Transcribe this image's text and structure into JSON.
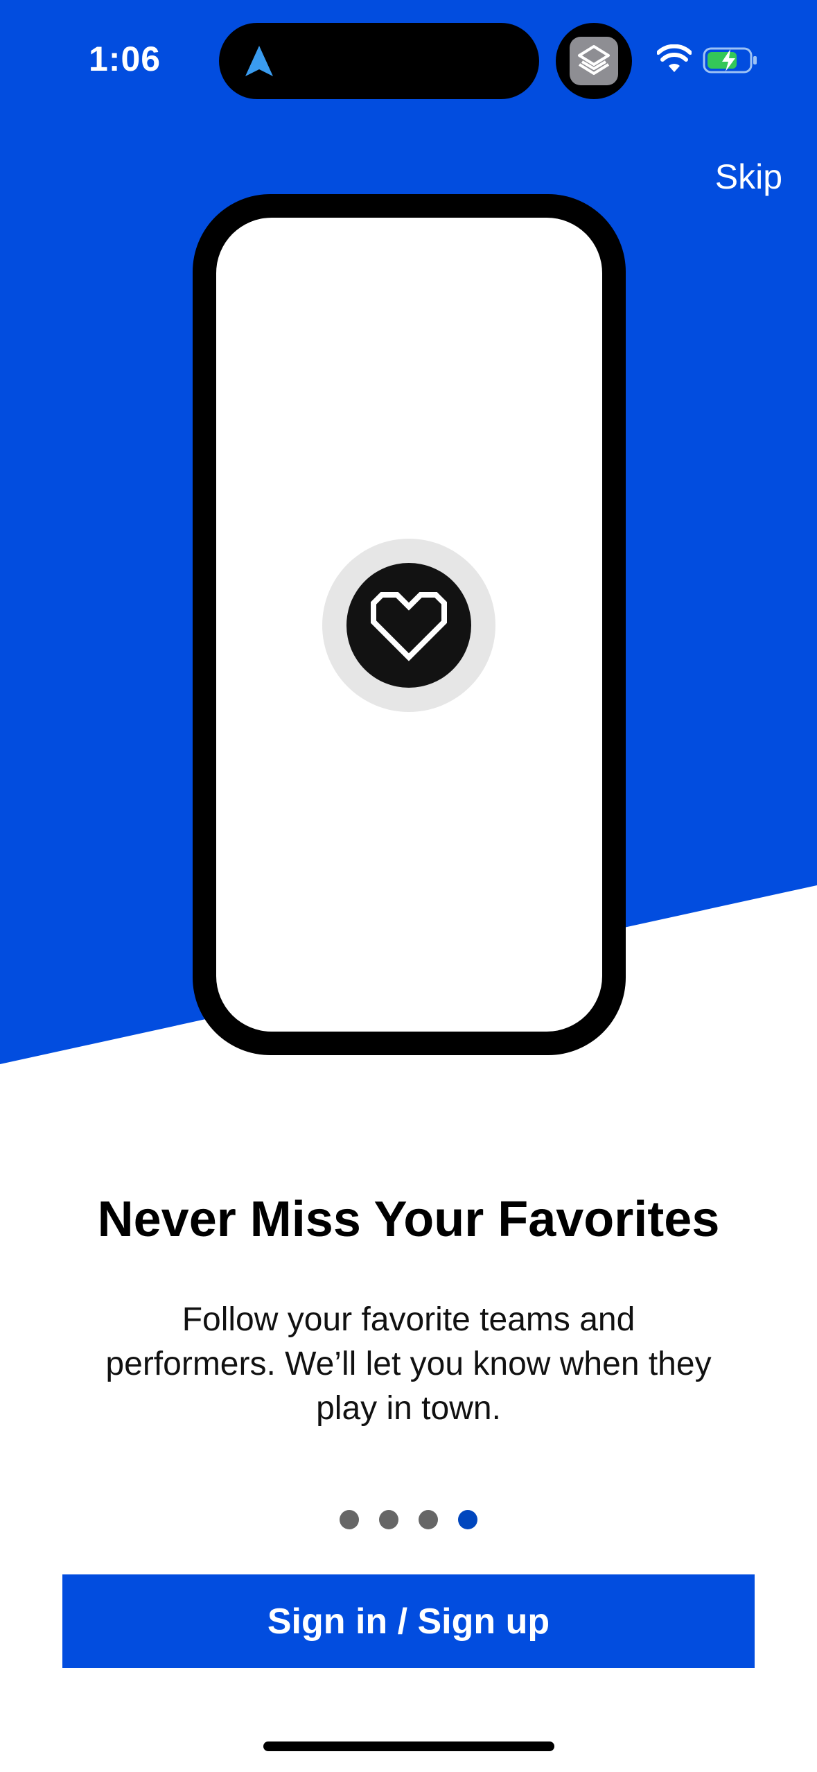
{
  "status_bar": {
    "time": "1:06"
  },
  "onboarding": {
    "skip_label": "Skip",
    "headline": "Never Miss Your Favorites",
    "body": "Follow your favorite teams and performers. We’ll let you know when they play in town.",
    "page_count": 4,
    "current_page": 4,
    "cta_label": "Sign in / Sign up"
  },
  "colors": {
    "brand_blue": "#024ddf",
    "active_dot": "#0046be",
    "inactive_dot": "#666666"
  },
  "icons": {
    "nav": "location-arrow-icon",
    "app": "layers-icon",
    "wifi": "wifi-icon",
    "battery": "battery-charging-icon",
    "illustration": "heart-icon"
  }
}
